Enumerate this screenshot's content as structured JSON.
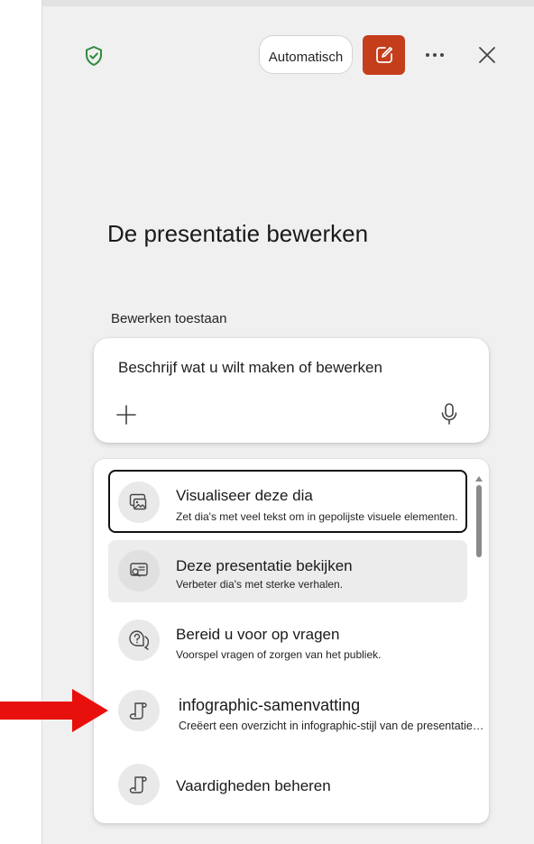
{
  "header": {
    "mode_label": "Automatisch",
    "icons": {
      "shield": "shield-check-icon",
      "edit": "compose-icon",
      "more": "more-horizontal-icon",
      "close": "close-icon"
    },
    "colors": {
      "edit_button": "#c43e1c",
      "shield": "#2e8b3e"
    }
  },
  "title": "De presentatie bewerken",
  "subhead": "Bewerken toestaan",
  "composer": {
    "prompt": "Beschrijf wat u wilt maken of bewerken",
    "icons": {
      "add": "plus-icon",
      "mic": "microphone-icon"
    }
  },
  "menu": {
    "items": [
      {
        "title": "Visualiseer deze dia",
        "desc": "Zet dia's met veel tekst om in gepolijste visuele elementen.",
        "icon": "visualize-slide-icon"
      },
      {
        "title": "Deze presentatie bekijken",
        "desc": "Verbeter dia's met sterke verhalen.",
        "icon": "review-presentation-icon"
      },
      {
        "title": "Bereid u voor op vragen",
        "desc": "Voorspel vragen of zorgen van het publiek.",
        "icon": "question-chat-icon"
      },
      {
        "title": "infographic-samenvatting",
        "desc": "Creëert een overzicht in infographic-stijl van de presentatie…",
        "icon": "scroll-icon"
      },
      {
        "title": "Vaardigheden beheren",
        "icon": "scroll-icon"
      }
    ]
  },
  "annotation": {
    "arrow_color": "#e8100c",
    "icon": "red-arrow-icon"
  }
}
